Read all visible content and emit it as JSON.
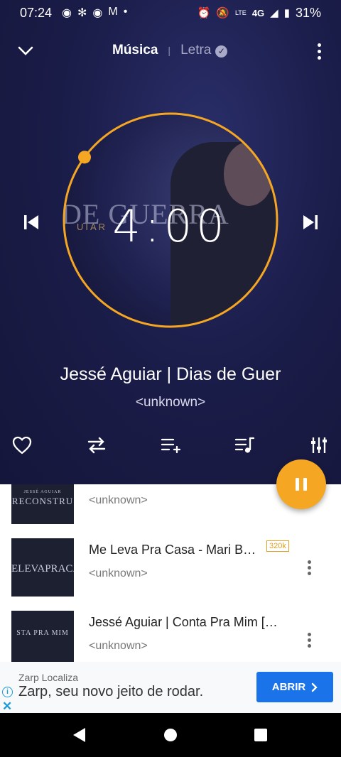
{
  "status_bar": {
    "time": "07:24",
    "battery": "31%",
    "network": "4G",
    "lte": "LTE",
    "volte": "VoLTE"
  },
  "header": {
    "tab_music": "Música",
    "tab_separator": "|",
    "tab_lyrics": "Letra"
  },
  "player": {
    "album_art_text": "DE GUERRA",
    "album_art_subtext": "UIAR",
    "clock": "4:00",
    "track_title": "Jessé Aguiar | Dias de Guer",
    "track_artist": "<unknown>",
    "progress": 0.03,
    "accent_color": "#f5a623"
  },
  "controls": {
    "favorite": "heart-icon",
    "repeat": "repeat-icon",
    "add_to_playlist": "playlist-add-icon",
    "queue": "queue-music-icon",
    "equalizer": "equalizer-icon"
  },
  "list": {
    "items": [
      {
        "title": "",
        "subtitle": "<unknown>",
        "thumb_text": "RECONSTRU",
        "thumb_top": "JESSÉ AGUIAR"
      },
      {
        "title": "Me Leva Pra Casa - Mari B…",
        "subtitle": "<unknown>",
        "badge": "320k",
        "thumb_text": "ELEVAPRACA"
      },
      {
        "title": "Jessé Aguiar | Conta Pra Mim […",
        "subtitle": "<unknown>",
        "thumb_text": "STA PRA MIM"
      }
    ]
  },
  "ad": {
    "label": "Zarp Localiza",
    "text": "Zarp, seu novo jeito de rodar.",
    "button": "ABRIR",
    "info": "i",
    "close": "✕"
  }
}
